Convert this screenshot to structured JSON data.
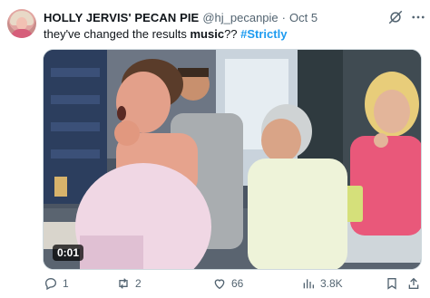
{
  "tweet": {
    "author": {
      "name": "HOLLY JERVIS' PECAN PIE",
      "handle": "@hj_pecanpie",
      "separator": "·",
      "timestamp": "Oct 5"
    },
    "text": {
      "part1": "they've changed the results ",
      "bold": "music",
      "part2": "?? ",
      "hashtag": "#Strictly"
    },
    "media": {
      "type": "video",
      "duration": "0:01"
    },
    "actions": {
      "replies": "1",
      "reposts": "2",
      "likes": "66",
      "views": "3.8K"
    },
    "colors": {
      "accent": "#1d9bf0",
      "secondary_text": "#536471",
      "primary_text": "#0f1419"
    },
    "icons": [
      "grok-icon",
      "more-icon",
      "reply-icon",
      "repost-icon",
      "like-icon",
      "views-icon",
      "bookmark-icon",
      "share-icon"
    ]
  }
}
